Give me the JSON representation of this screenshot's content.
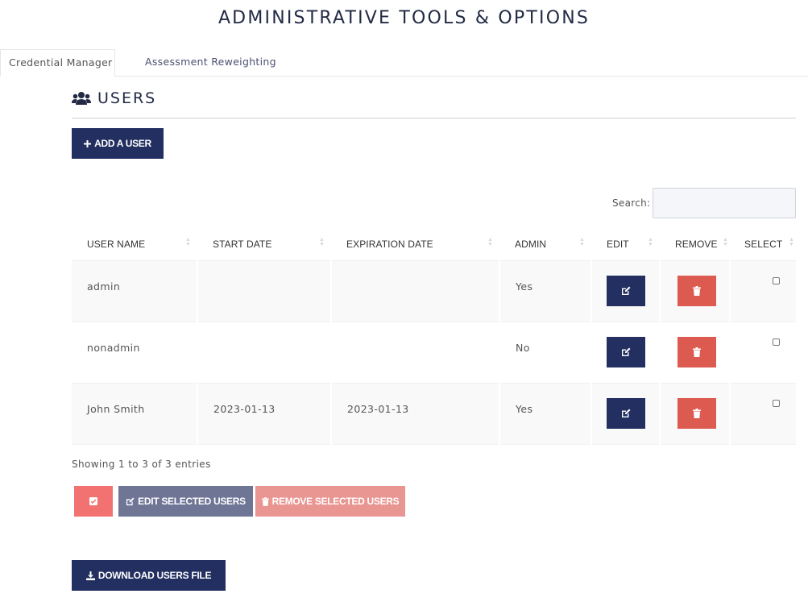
{
  "header": {
    "title": "ADMINISTRATIVE TOOLS & OPTIONS"
  },
  "tabs": [
    {
      "label": "Credential Manager",
      "active": true
    },
    {
      "label": "Assessment Reweighting",
      "active": false
    }
  ],
  "users_section": {
    "title": "USERS",
    "icon": "users-icon",
    "add_button_label": "ADD A USER"
  },
  "search": {
    "label": "Search:",
    "value": ""
  },
  "table": {
    "columns": [
      "USER NAME",
      "START DATE",
      "EXPIRATION DATE",
      "ADMIN",
      "EDIT",
      "REMOVE",
      "SELECT"
    ],
    "rows": [
      {
        "user_name": "admin",
        "start_date": "",
        "expiration_date": "",
        "admin": "Yes",
        "selected": false
      },
      {
        "user_name": "nonadmin",
        "start_date": "",
        "expiration_date": "",
        "admin": "No",
        "selected": false
      },
      {
        "user_name": "John Smith",
        "start_date": "2023-01-13",
        "expiration_date": "2023-01-13",
        "admin": "Yes",
        "selected": false
      }
    ]
  },
  "info": "Showing 1 to 3 of 3 entries",
  "bulk_actions": {
    "edit_label": "EDIT SELECTED USERS",
    "remove_label": "REMOVE SELECTED USERS"
  },
  "download_label": "DOWNLOAD USERS FILE",
  "colors": {
    "navy": "#222f60",
    "danger": "#dd5a50",
    "select_all": "#f27272",
    "muted_navy": "#6e7595",
    "muted_danger": "#e99591"
  }
}
